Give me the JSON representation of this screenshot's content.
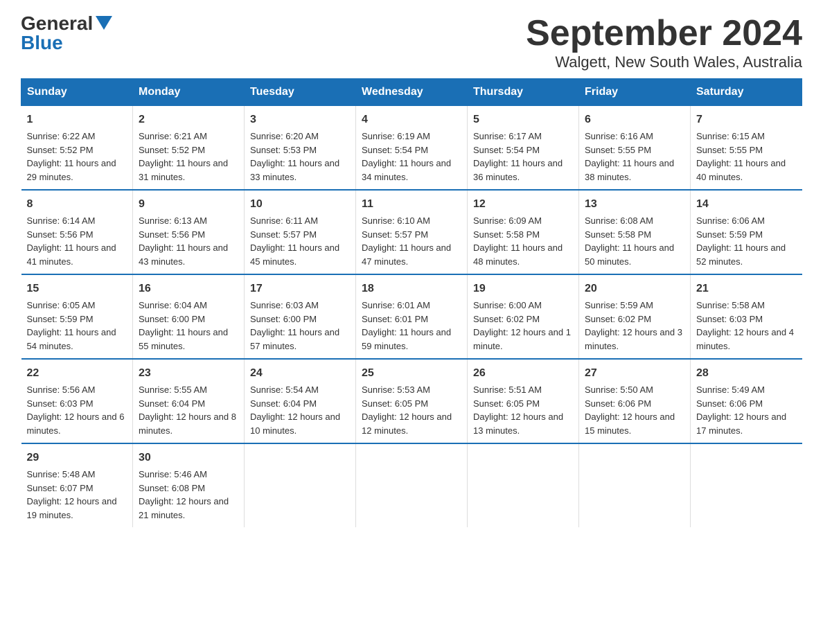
{
  "logo": {
    "general": "General",
    "blue": "Blue"
  },
  "title": {
    "month": "September 2024",
    "location": "Walgett, New South Wales, Australia"
  },
  "headers": [
    "Sunday",
    "Monday",
    "Tuesday",
    "Wednesday",
    "Thursday",
    "Friday",
    "Saturday"
  ],
  "weeks": [
    [
      {
        "day": "1",
        "sunrise": "6:22 AM",
        "sunset": "5:52 PM",
        "daylight": "11 hours and 29 minutes."
      },
      {
        "day": "2",
        "sunrise": "6:21 AM",
        "sunset": "5:52 PM",
        "daylight": "11 hours and 31 minutes."
      },
      {
        "day": "3",
        "sunrise": "6:20 AM",
        "sunset": "5:53 PM",
        "daylight": "11 hours and 33 minutes."
      },
      {
        "day": "4",
        "sunrise": "6:19 AM",
        "sunset": "5:54 PM",
        "daylight": "11 hours and 34 minutes."
      },
      {
        "day": "5",
        "sunrise": "6:17 AM",
        "sunset": "5:54 PM",
        "daylight": "11 hours and 36 minutes."
      },
      {
        "day": "6",
        "sunrise": "6:16 AM",
        "sunset": "5:55 PM",
        "daylight": "11 hours and 38 minutes."
      },
      {
        "day": "7",
        "sunrise": "6:15 AM",
        "sunset": "5:55 PM",
        "daylight": "11 hours and 40 minutes."
      }
    ],
    [
      {
        "day": "8",
        "sunrise": "6:14 AM",
        "sunset": "5:56 PM",
        "daylight": "11 hours and 41 minutes."
      },
      {
        "day": "9",
        "sunrise": "6:13 AM",
        "sunset": "5:56 PM",
        "daylight": "11 hours and 43 minutes."
      },
      {
        "day": "10",
        "sunrise": "6:11 AM",
        "sunset": "5:57 PM",
        "daylight": "11 hours and 45 minutes."
      },
      {
        "day": "11",
        "sunrise": "6:10 AM",
        "sunset": "5:57 PM",
        "daylight": "11 hours and 47 minutes."
      },
      {
        "day": "12",
        "sunrise": "6:09 AM",
        "sunset": "5:58 PM",
        "daylight": "11 hours and 48 minutes."
      },
      {
        "day": "13",
        "sunrise": "6:08 AM",
        "sunset": "5:58 PM",
        "daylight": "11 hours and 50 minutes."
      },
      {
        "day": "14",
        "sunrise": "6:06 AM",
        "sunset": "5:59 PM",
        "daylight": "11 hours and 52 minutes."
      }
    ],
    [
      {
        "day": "15",
        "sunrise": "6:05 AM",
        "sunset": "5:59 PM",
        "daylight": "11 hours and 54 minutes."
      },
      {
        "day": "16",
        "sunrise": "6:04 AM",
        "sunset": "6:00 PM",
        "daylight": "11 hours and 55 minutes."
      },
      {
        "day": "17",
        "sunrise": "6:03 AM",
        "sunset": "6:00 PM",
        "daylight": "11 hours and 57 minutes."
      },
      {
        "day": "18",
        "sunrise": "6:01 AM",
        "sunset": "6:01 PM",
        "daylight": "11 hours and 59 minutes."
      },
      {
        "day": "19",
        "sunrise": "6:00 AM",
        "sunset": "6:02 PM",
        "daylight": "12 hours and 1 minute."
      },
      {
        "day": "20",
        "sunrise": "5:59 AM",
        "sunset": "6:02 PM",
        "daylight": "12 hours and 3 minutes."
      },
      {
        "day": "21",
        "sunrise": "5:58 AM",
        "sunset": "6:03 PM",
        "daylight": "12 hours and 4 minutes."
      }
    ],
    [
      {
        "day": "22",
        "sunrise": "5:56 AM",
        "sunset": "6:03 PM",
        "daylight": "12 hours and 6 minutes."
      },
      {
        "day": "23",
        "sunrise": "5:55 AM",
        "sunset": "6:04 PM",
        "daylight": "12 hours and 8 minutes."
      },
      {
        "day": "24",
        "sunrise": "5:54 AM",
        "sunset": "6:04 PM",
        "daylight": "12 hours and 10 minutes."
      },
      {
        "day": "25",
        "sunrise": "5:53 AM",
        "sunset": "6:05 PM",
        "daylight": "12 hours and 12 minutes."
      },
      {
        "day": "26",
        "sunrise": "5:51 AM",
        "sunset": "6:05 PM",
        "daylight": "12 hours and 13 minutes."
      },
      {
        "day": "27",
        "sunrise": "5:50 AM",
        "sunset": "6:06 PM",
        "daylight": "12 hours and 15 minutes."
      },
      {
        "day": "28",
        "sunrise": "5:49 AM",
        "sunset": "6:06 PM",
        "daylight": "12 hours and 17 minutes."
      }
    ],
    [
      {
        "day": "29",
        "sunrise": "5:48 AM",
        "sunset": "6:07 PM",
        "daylight": "12 hours and 19 minutes."
      },
      {
        "day": "30",
        "sunrise": "5:46 AM",
        "sunset": "6:08 PM",
        "daylight": "12 hours and 21 minutes."
      },
      null,
      null,
      null,
      null,
      null
    ]
  ],
  "labels": {
    "sunrise": "Sunrise:",
    "sunset": "Sunset:",
    "daylight": "Daylight:"
  }
}
